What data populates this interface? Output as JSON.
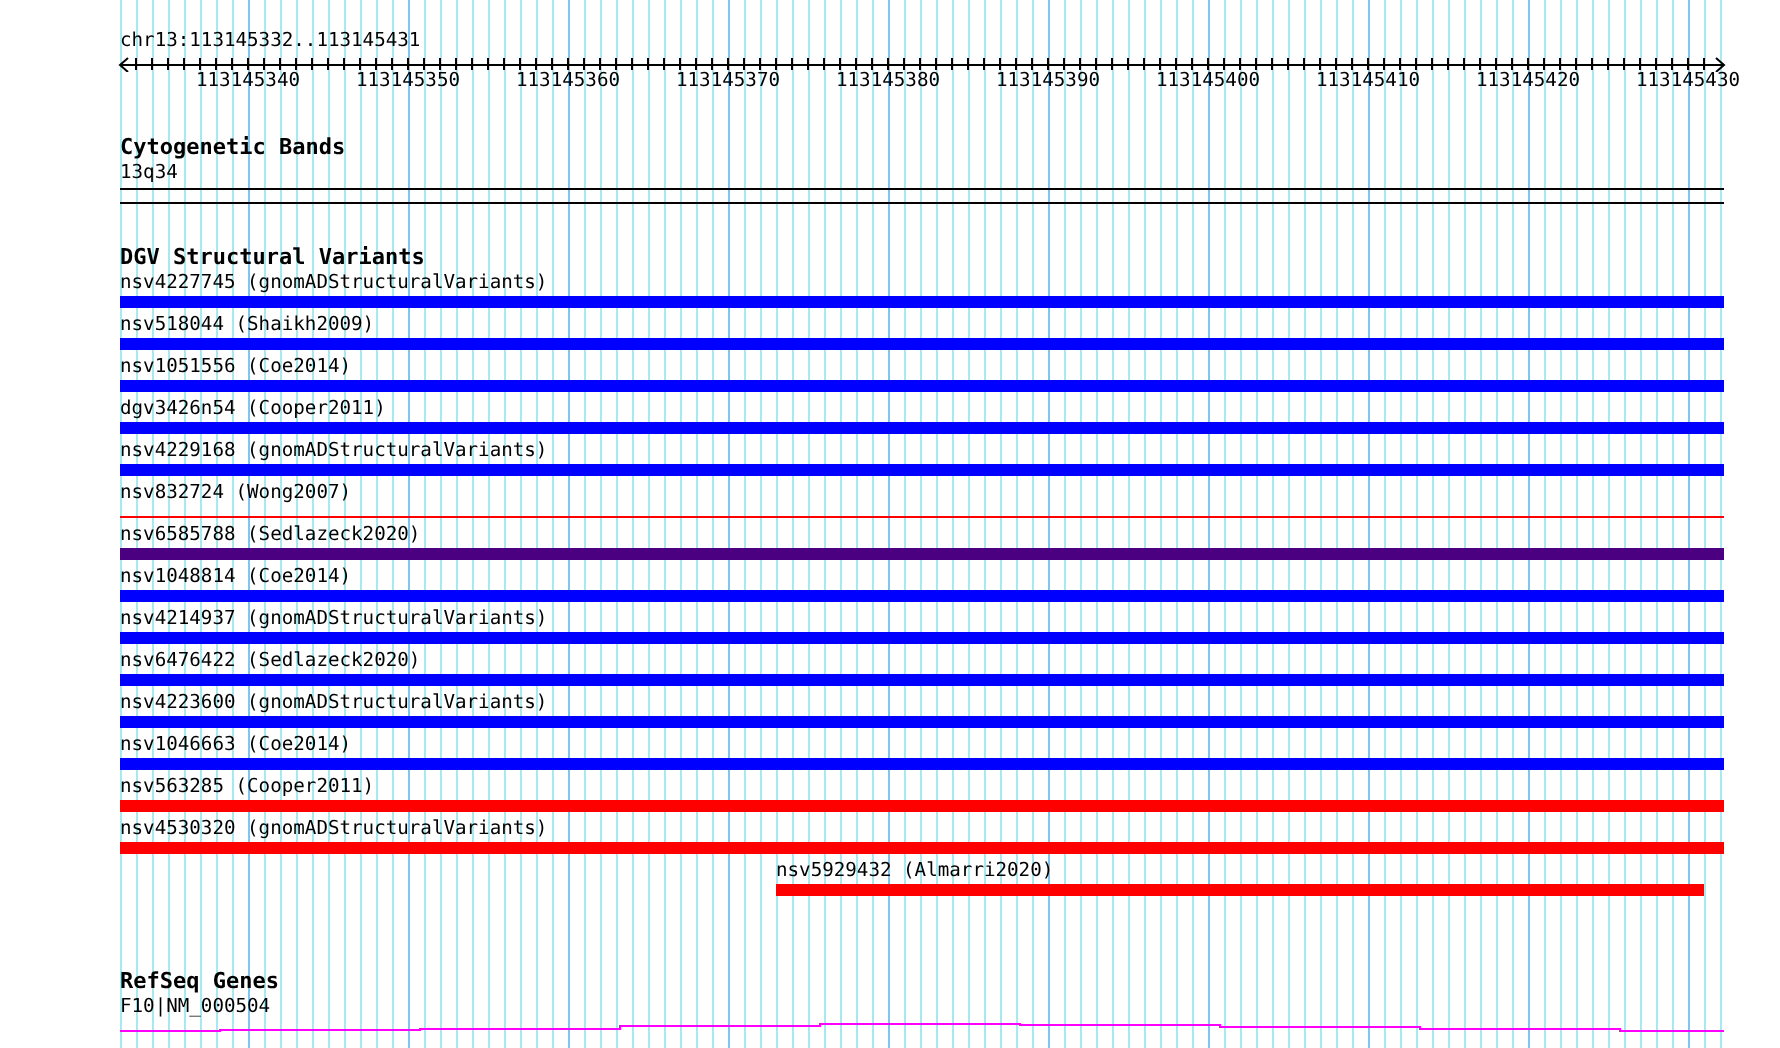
{
  "ruler": {
    "location": "chr13:113145332..113145431",
    "labels": [
      "113145340",
      "113145350",
      "113145360",
      "113145370",
      "113145380",
      "113145390",
      "113145400",
      "113145410",
      "113145420",
      "113145430"
    ]
  },
  "cytogenetic_bands": {
    "title": "Cytogenetic Bands",
    "band": "13q34"
  },
  "dgv": {
    "title": "DGV Structural Variants",
    "variants": [
      {
        "label": "nsv4227745 (gnomADStructuralVariants)",
        "color": "#0000ff",
        "kind": "bar"
      },
      {
        "label": "nsv518044 (Shaikh2009)",
        "color": "#0000ff",
        "kind": "bar"
      },
      {
        "label": "nsv1051556 (Coe2014)",
        "color": "#0000ff",
        "kind": "bar"
      },
      {
        "label": "dgv3426n54 (Cooper2011)",
        "color": "#0000ff",
        "kind": "bar"
      },
      {
        "label": "nsv4229168 (gnomADStructuralVariants)",
        "color": "#0000ff",
        "kind": "bar"
      },
      {
        "label": "nsv832724 (Wong2007)",
        "color": "#ff0000",
        "kind": "line"
      },
      {
        "label": "nsv6585788 (Sedlazeck2020)",
        "color": "#4b0082",
        "kind": "bar"
      },
      {
        "label": "nsv1048814 (Coe2014)",
        "color": "#0000ff",
        "kind": "bar"
      },
      {
        "label": "nsv4214937 (gnomADStructuralVariants)",
        "color": "#0000ff",
        "kind": "bar"
      },
      {
        "label": "nsv6476422 (Sedlazeck2020)",
        "color": "#0000ff",
        "kind": "bar"
      },
      {
        "label": "nsv4223600 (gnomADStructuralVariants)",
        "color": "#0000ff",
        "kind": "bar"
      },
      {
        "label": "nsv1046663 (Coe2014)",
        "color": "#0000ff",
        "kind": "bar"
      },
      {
        "label": "nsv563285 (Cooper2011)",
        "color": "#ff0000",
        "kind": "bar"
      },
      {
        "label": "nsv4530320 (gnomADStructuralVariants)",
        "color": "#ff0000",
        "kind": "bar"
      },
      {
        "label": "nsv5929432 (Almarri2020)",
        "color": "#ff0000",
        "kind": "partial"
      }
    ]
  },
  "refseq": {
    "title": "RefSeq Genes",
    "gene": "F10|NM_000504"
  }
}
